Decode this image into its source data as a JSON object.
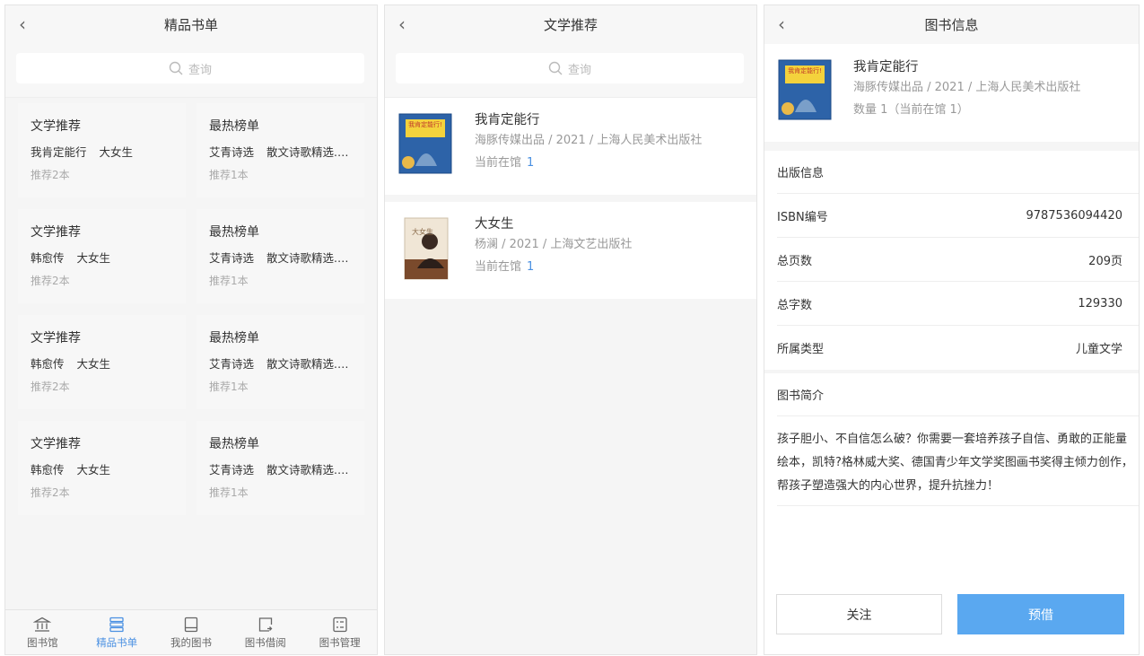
{
  "colors": {
    "accent": "#4a90e2",
    "button_primary": "#5aa8f0",
    "background": "#f5f5f5",
    "card": "#f7f7f7"
  },
  "screen1": {
    "title": "精品书单",
    "search_placeholder": "查询",
    "cards": [
      {
        "title": "文学推荐",
        "books": [
          "我肯定能行",
          "大女生"
        ],
        "count": "推荐2本"
      },
      {
        "title": "最热榜单",
        "books": [
          "艾青诗选",
          "散文诗歌精选..."
        ],
        "count": "推荐1本"
      },
      {
        "title": "文学推荐",
        "books": [
          "韩愈传",
          "大女生"
        ],
        "count": "推荐2本"
      },
      {
        "title": "最热榜单",
        "books": [
          "艾青诗选",
          "散文诗歌精选..."
        ],
        "count": "推荐1本"
      },
      {
        "title": "文学推荐",
        "books": [
          "韩愈传",
          "大女生"
        ],
        "count": "推荐2本"
      },
      {
        "title": "最热榜单",
        "books": [
          "艾青诗选",
          "散文诗歌精选..."
        ],
        "count": "推荐1本"
      },
      {
        "title": "文学推荐",
        "books": [
          "韩愈传",
          "大女生"
        ],
        "count": "推荐2本"
      },
      {
        "title": "最热榜单",
        "books": [
          "艾青诗选",
          "散文诗歌精选..."
        ],
        "count": "推荐1本"
      }
    ],
    "tabs": [
      {
        "label": "图书馆",
        "icon": "library-icon",
        "active": false
      },
      {
        "label": "精品书单",
        "icon": "booklist-icon",
        "active": true
      },
      {
        "label": "我的图书",
        "icon": "book-icon",
        "active": false
      },
      {
        "label": "图书借阅",
        "icon": "borrow-icon",
        "active": false
      },
      {
        "label": "图书管理",
        "icon": "manage-icon",
        "active": false
      }
    ]
  },
  "screen2": {
    "title": "文学推荐",
    "search_placeholder": "查询",
    "items": [
      {
        "name": "我肯定能行",
        "publisher": "海豚传媒出品 / 2021 / 上海人民美术出版社",
        "stock_label": "当前在馆",
        "stock": "1",
        "cover_text": "我肯定能行!"
      },
      {
        "name": "大女生",
        "publisher": "杨澜 / 2021 / 上海文艺出版社",
        "stock_label": "当前在馆",
        "stock": "1",
        "cover_text": "大女生"
      }
    ]
  },
  "screen3": {
    "title": "图书信息",
    "book": {
      "name": "我肯定能行",
      "publisher": "海豚传媒出品 / 2021 / 上海人民美术出版社",
      "quantity": "数量 1（当前在馆 1）",
      "cover_text": "我肯定能行!"
    },
    "publish_section_title": "出版信息",
    "details": [
      {
        "label": "ISBN编号",
        "value": "9787536094420"
      },
      {
        "label": "总页数",
        "value": "209页"
      },
      {
        "label": "总字数",
        "value": "129330"
      },
      {
        "label": "所属类型",
        "value": "儿童文学"
      }
    ],
    "intro_title": "图书简介",
    "intro": "孩子胆小、不自信怎么破？你需要一套培养孩子自信、勇敢的正能量绘本，凯特?格林威大奖、德国青少年文学奖图画书奖得主倾力创作，帮孩子塑造强大的内心世界，提升抗挫力！",
    "follow_label": "关注",
    "reserve_label": "预借"
  }
}
